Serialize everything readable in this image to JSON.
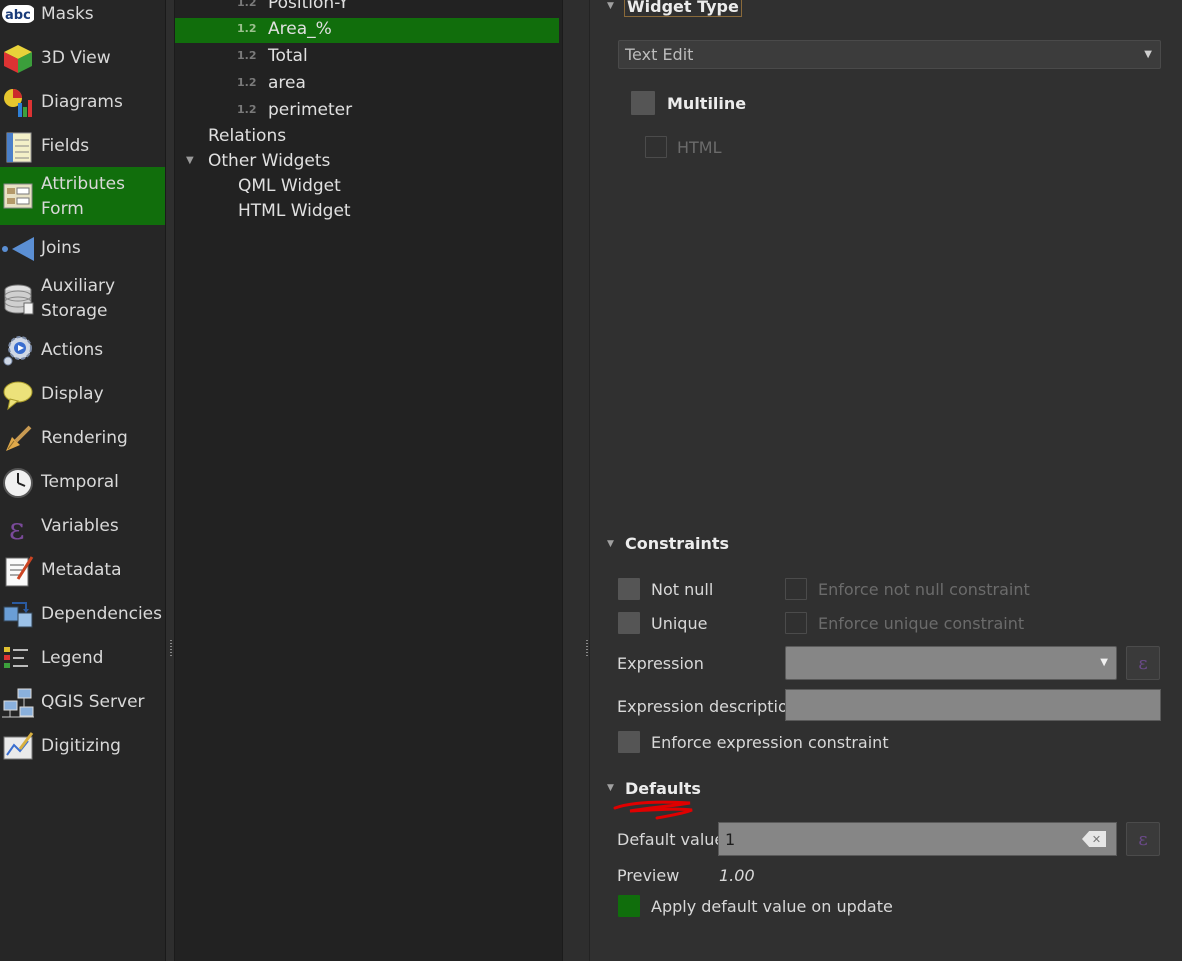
{
  "sidebar": {
    "items": [
      {
        "label": "Masks",
        "icon": "masks-icon"
      },
      {
        "label": "3D View",
        "icon": "3d-view-icon"
      },
      {
        "label": "Diagrams",
        "icon": "diagrams-icon"
      },
      {
        "label": "Fields",
        "icon": "fields-icon"
      },
      {
        "label": "Attributes Form",
        "line1": "Attributes",
        "line2": "Form",
        "icon": "attributes-form-icon",
        "active": true
      },
      {
        "label": "Joins",
        "icon": "joins-icon"
      },
      {
        "label": "Auxiliary Storage",
        "line1": "Auxiliary",
        "line2": "Storage",
        "icon": "auxiliary-storage-icon"
      },
      {
        "label": "Actions",
        "icon": "actions-icon"
      },
      {
        "label": "Display",
        "icon": "display-icon"
      },
      {
        "label": "Rendering",
        "icon": "rendering-icon"
      },
      {
        "label": "Temporal",
        "icon": "temporal-icon"
      },
      {
        "label": "Variables",
        "icon": "variables-icon"
      },
      {
        "label": "Metadata",
        "icon": "metadata-icon"
      },
      {
        "label": "Dependencies",
        "icon": "dependencies-icon"
      },
      {
        "label": "Legend",
        "icon": "legend-icon"
      },
      {
        "label": "QGIS Server",
        "icon": "qgis-server-icon"
      },
      {
        "label": "Digitizing",
        "icon": "digitizing-icon"
      }
    ]
  },
  "tree": {
    "type_badge": "1.2",
    "fields": [
      "Position-Y",
      "Area_%",
      "Total",
      "area",
      "perimeter"
    ],
    "selected_field": "Area_%",
    "relations": "Relations",
    "other_widgets": "Other Widgets",
    "qml_widget": "QML Widget",
    "html_widget": "HTML Widget"
  },
  "widget_type": {
    "title": "Widget Type",
    "selected": "Text Edit",
    "multiline_label": "Multiline",
    "html_label": "HTML"
  },
  "constraints": {
    "title": "Constraints",
    "not_null": "Not null",
    "enforce_not_null": "Enforce not null constraint",
    "unique": "Unique",
    "enforce_unique": "Enforce unique constraint",
    "expression_label": "Expression",
    "expression_desc_label": "Expression description",
    "enforce_expression": "Enforce expression constraint"
  },
  "defaults": {
    "title": "Defaults",
    "default_value_label": "Default value",
    "default_value": "1",
    "preview_label": "Preview",
    "preview_value": "1.00",
    "apply_on_update": "Apply default value on update"
  },
  "colors": {
    "accent_green": "#116e0c",
    "annotation_red": "#e00000"
  }
}
